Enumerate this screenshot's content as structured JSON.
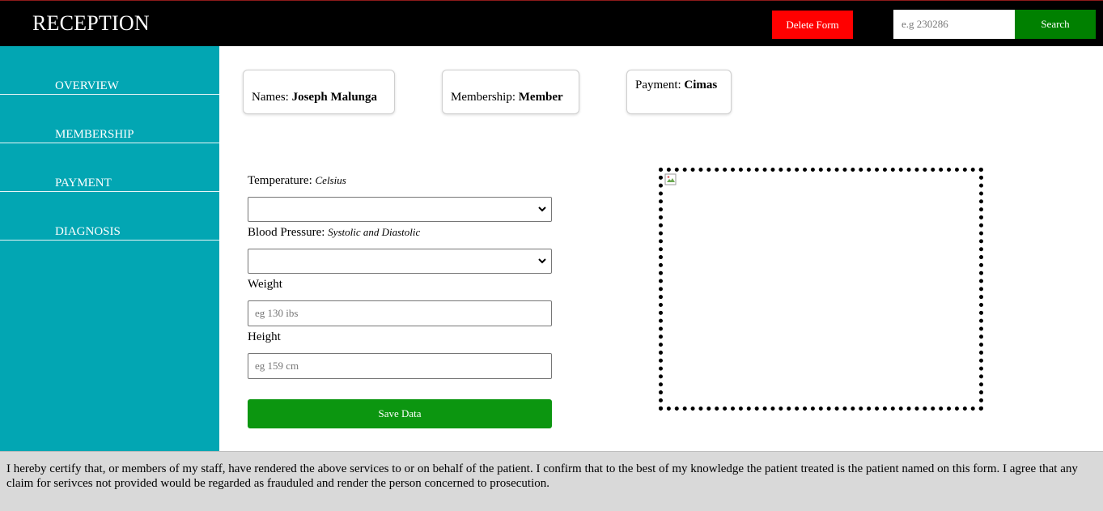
{
  "header": {
    "title": "RECEPTION",
    "delete_label": "Delete Form",
    "search_placeholder": "e.g 230286",
    "search_label": "Search"
  },
  "sidebar": {
    "items": [
      {
        "label": "OVERVIEW"
      },
      {
        "label": "MEMBERSHIP"
      },
      {
        "label": "PAYMENT"
      },
      {
        "label": "DIAGNOSIS"
      }
    ]
  },
  "cards": {
    "names": {
      "label": "Names:",
      "value": "Joseph Malunga"
    },
    "membership": {
      "label": "Membership:",
      "value": "Member"
    },
    "payment": {
      "label": "Payment:",
      "value": "Cimas"
    }
  },
  "form": {
    "temperature": {
      "label": "Temperature:",
      "hint": "Celsius",
      "selected": ""
    },
    "blood_pressure": {
      "label": "Blood Pressure:",
      "hint": "Systolic and Diastolic",
      "selected": ""
    },
    "weight": {
      "label": "Weight",
      "placeholder": "eg 130 ibs",
      "value": ""
    },
    "height": {
      "label": "Height",
      "placeholder": "eg 159 cm",
      "value": ""
    },
    "save_label": "Save Data"
  },
  "footer": {
    "text": "I hereby certify that, or members of my staff, have rendered the above services to or on behalf of the patient. I confirm that to the best of my knowledge the patient treated is the patient named on this form. I agree that any claim for serivces not provided would be regarded as frauduled and render the person concerned to prosecution."
  },
  "icons": {
    "select_arrow": "chevron-down-icon",
    "broken_image": "broken-image-icon"
  },
  "colors": {
    "topbar": "#000000",
    "sidebar": "#02a6b3",
    "delete": "#ff0000",
    "search": "#008000",
    "save": "#0c9610",
    "footer": "#d9d9d9"
  }
}
